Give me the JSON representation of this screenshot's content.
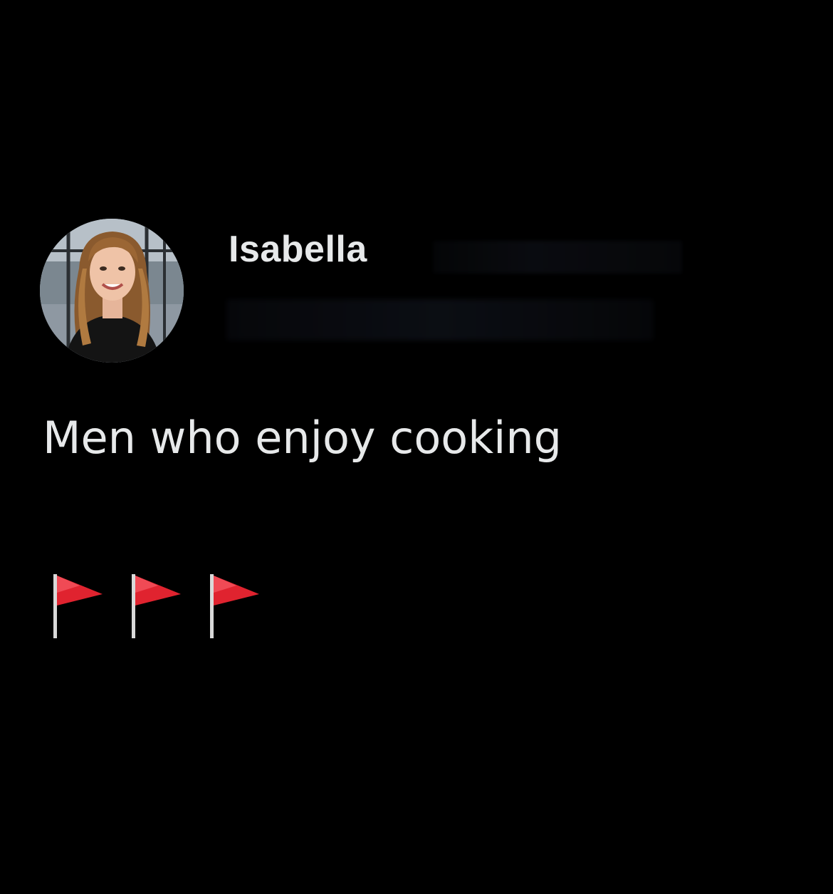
{
  "post": {
    "author_name": "Isabella",
    "text": "Men who enjoy cooking",
    "emoji": [
      {
        "icon": "red-flag-icon",
        "char": "🚩"
      },
      {
        "icon": "red-flag-icon",
        "char": "🚩"
      },
      {
        "icon": "red-flag-icon",
        "char": "🚩"
      }
    ]
  },
  "colors": {
    "background": "#000000",
    "text": "#e7e9ea",
    "flag_red": "#e0232f",
    "flag_pole": "#d9d9d9"
  }
}
